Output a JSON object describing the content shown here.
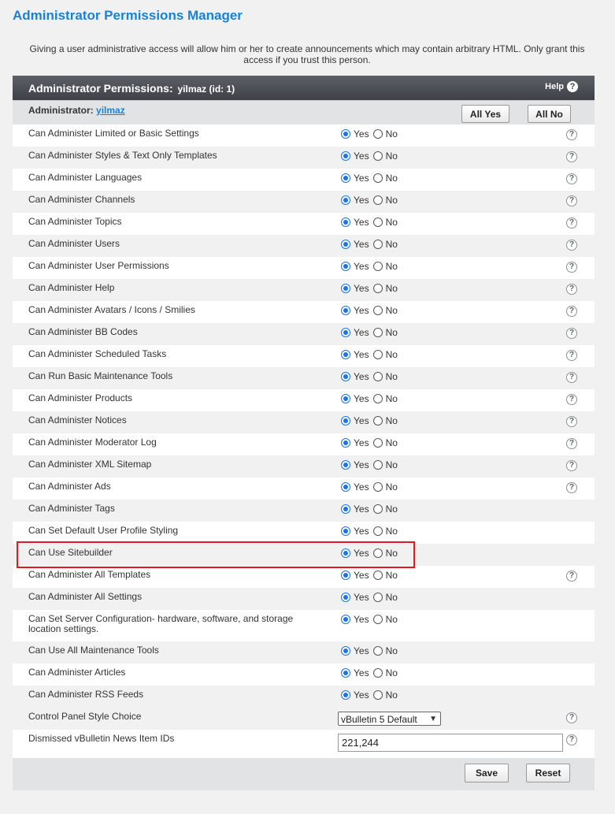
{
  "page": {
    "title": "Administrator Permissions Manager",
    "intro": "Giving a user administrative access will allow him or her to create announcements which may contain arbitrary HTML. Only grant this access if you trust this person."
  },
  "panel": {
    "title": "Administrator Permissions:",
    "user_info": "yilmaz (id: 1)",
    "help_label": "Help",
    "administrator_label": "Administrator:",
    "administrator_name": "yilmaz",
    "all_yes_label": "All Yes",
    "all_no_label": "All No"
  },
  "radio_labels": {
    "yes": "Yes",
    "no": "No"
  },
  "permissions": [
    {
      "label": "Can Administer Limited or Basic Settings",
      "value": "Yes",
      "help": true
    },
    {
      "label": "Can Administer Styles & Text Only Templates",
      "value": "Yes",
      "help": true
    },
    {
      "label": "Can Administer Languages",
      "value": "Yes",
      "help": true
    },
    {
      "label": "Can Administer Channels",
      "value": "Yes",
      "help": true
    },
    {
      "label": "Can Administer Topics",
      "value": "Yes",
      "help": true
    },
    {
      "label": "Can Administer Users",
      "value": "Yes",
      "help": true
    },
    {
      "label": "Can Administer User Permissions",
      "value": "Yes",
      "help": true
    },
    {
      "label": "Can Administer Help",
      "value": "Yes",
      "help": true
    },
    {
      "label": "Can Administer Avatars / Icons / Smilies",
      "value": "Yes",
      "help": true
    },
    {
      "label": "Can Administer BB Codes",
      "value": "Yes",
      "help": true
    },
    {
      "label": "Can Administer Scheduled Tasks",
      "value": "Yes",
      "help": true
    },
    {
      "label": "Can Run Basic Maintenance Tools",
      "value": "Yes",
      "help": true
    },
    {
      "label": "Can Administer Products",
      "value": "Yes",
      "help": true
    },
    {
      "label": "Can Administer Notices",
      "value": "Yes",
      "help": true
    },
    {
      "label": "Can Administer Moderator Log",
      "value": "Yes",
      "help": true
    },
    {
      "label": "Can Administer XML Sitemap",
      "value": "Yes",
      "help": true
    },
    {
      "label": "Can Administer Ads",
      "value": "Yes",
      "help": true
    },
    {
      "label": "Can Administer Tags",
      "value": "Yes",
      "help": false
    },
    {
      "label": "Can Set Default User Profile Styling",
      "value": "Yes",
      "help": false
    },
    {
      "label": "Can Use Sitebuilder",
      "value": "Yes",
      "help": false
    },
    {
      "label": "Can Administer All Templates",
      "value": "Yes",
      "help": true
    },
    {
      "label": "Can Administer All Settings",
      "value": "Yes",
      "help": false
    },
    {
      "label": "Can Set Server Configuration- hardware, software, and storage location settings.",
      "value": "Yes",
      "help": false,
      "tall": true
    },
    {
      "label": "Can Use All Maintenance Tools",
      "value": "Yes",
      "help": false
    },
    {
      "label": "Can Administer Articles",
      "value": "Yes",
      "help": false
    },
    {
      "label": "Can Administer RSS Feeds",
      "value": "Yes",
      "help": false
    }
  ],
  "style_choice": {
    "label": "Control Panel Style Choice",
    "value": "vBulletin 5 Default"
  },
  "dismissed_news": {
    "label": "Dismissed vBulletin News Item IDs",
    "value": "221,244"
  },
  "buttons": {
    "save": "Save",
    "reset": "Reset"
  },
  "colors": {
    "title_blue": "#1a82d6",
    "highlight": "#e5191d",
    "radio_checked": "#1a73e8"
  }
}
